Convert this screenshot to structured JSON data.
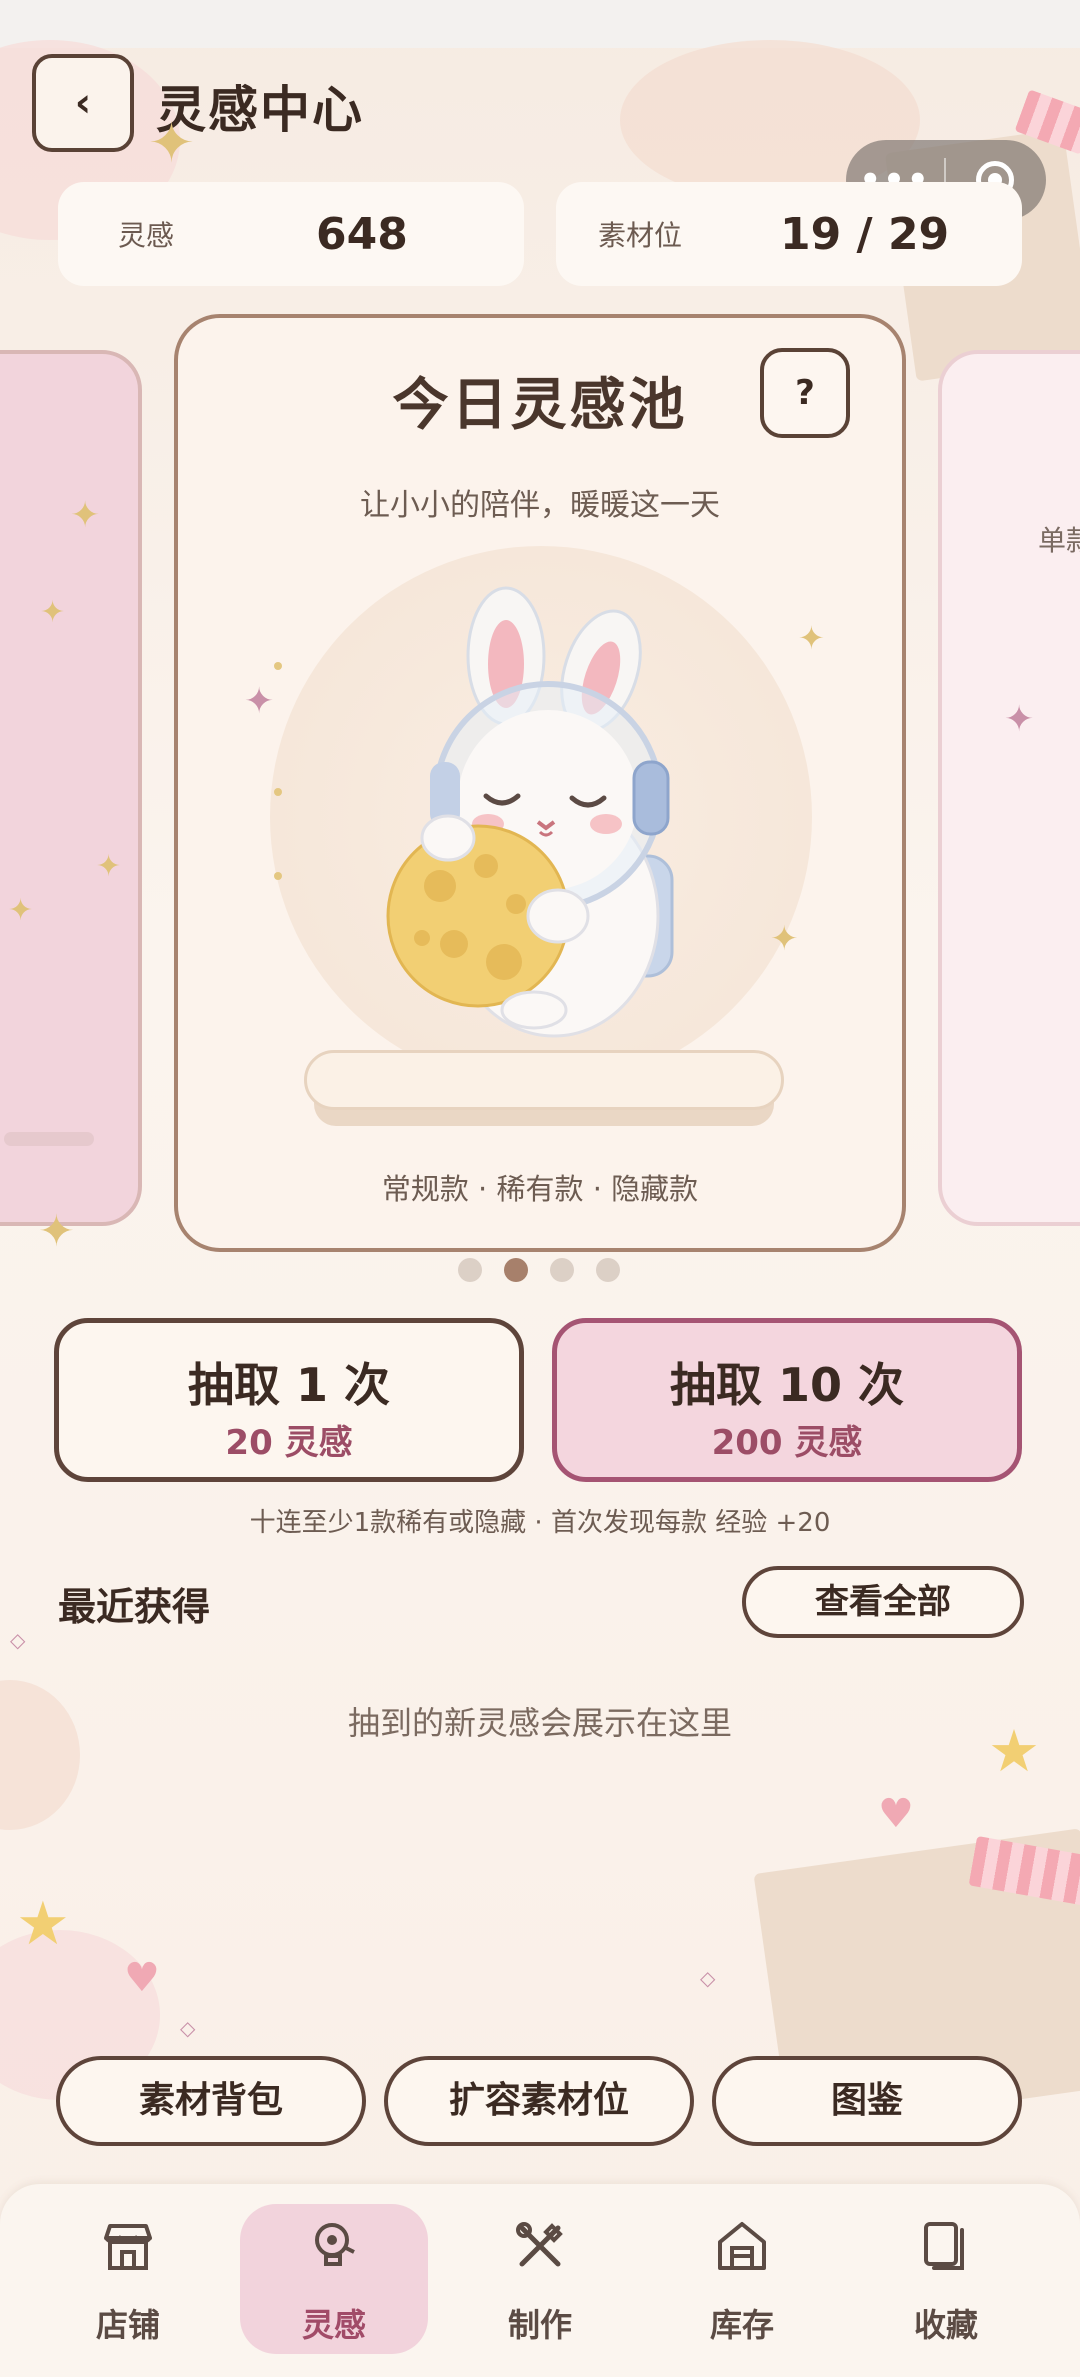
{
  "header": {
    "back_icon": "‹",
    "title": "灵感中心"
  },
  "stats": [
    {
      "label": "灵感",
      "value": "648"
    },
    {
      "label": "素材位",
      "value": "19 / 29"
    }
  ],
  "side_cards": {
    "right_text": "单款"
  },
  "pool": {
    "title": "今日灵感池",
    "help_label": "?",
    "subtitle": "让小小的陪伴，暖暖这一天",
    "tags": "常规款 · 稀有款 · 隐藏款",
    "illustration": "bunny-astronaut-hugging-moon"
  },
  "pager": {
    "count": 4,
    "active_index": 1
  },
  "draw": {
    "single": {
      "label": "抽取 1 次",
      "cost": "20 灵感"
    },
    "ten": {
      "label": "抽取 10 次",
      "cost": "200 灵感"
    },
    "hint": "十连至少1款稀有或隐藏 · 首次发现每款 经验 +20"
  },
  "recent": {
    "title": "最近获得",
    "view_all": "查看全部",
    "empty_text": "抽到的新灵感会展示在这里"
  },
  "actions": [
    "素材背包",
    "扩容素材位",
    "图鉴"
  ],
  "tabs": [
    {
      "label": "店铺",
      "icon": "shop-icon",
      "active": false
    },
    {
      "label": "灵感",
      "icon": "lightbulb-icon",
      "active": true
    },
    {
      "label": "制作",
      "icon": "tools-icon",
      "active": false
    },
    {
      "label": "库存",
      "icon": "warehouse-icon",
      "active": false
    },
    {
      "label": "收藏",
      "icon": "collection-icon",
      "active": false
    }
  ],
  "colors": {
    "accent_pink": "#a14b68",
    "border_brown": "#5e443a",
    "background": "#f7efe5",
    "active_tab_bg": "#f2d3dc"
  }
}
